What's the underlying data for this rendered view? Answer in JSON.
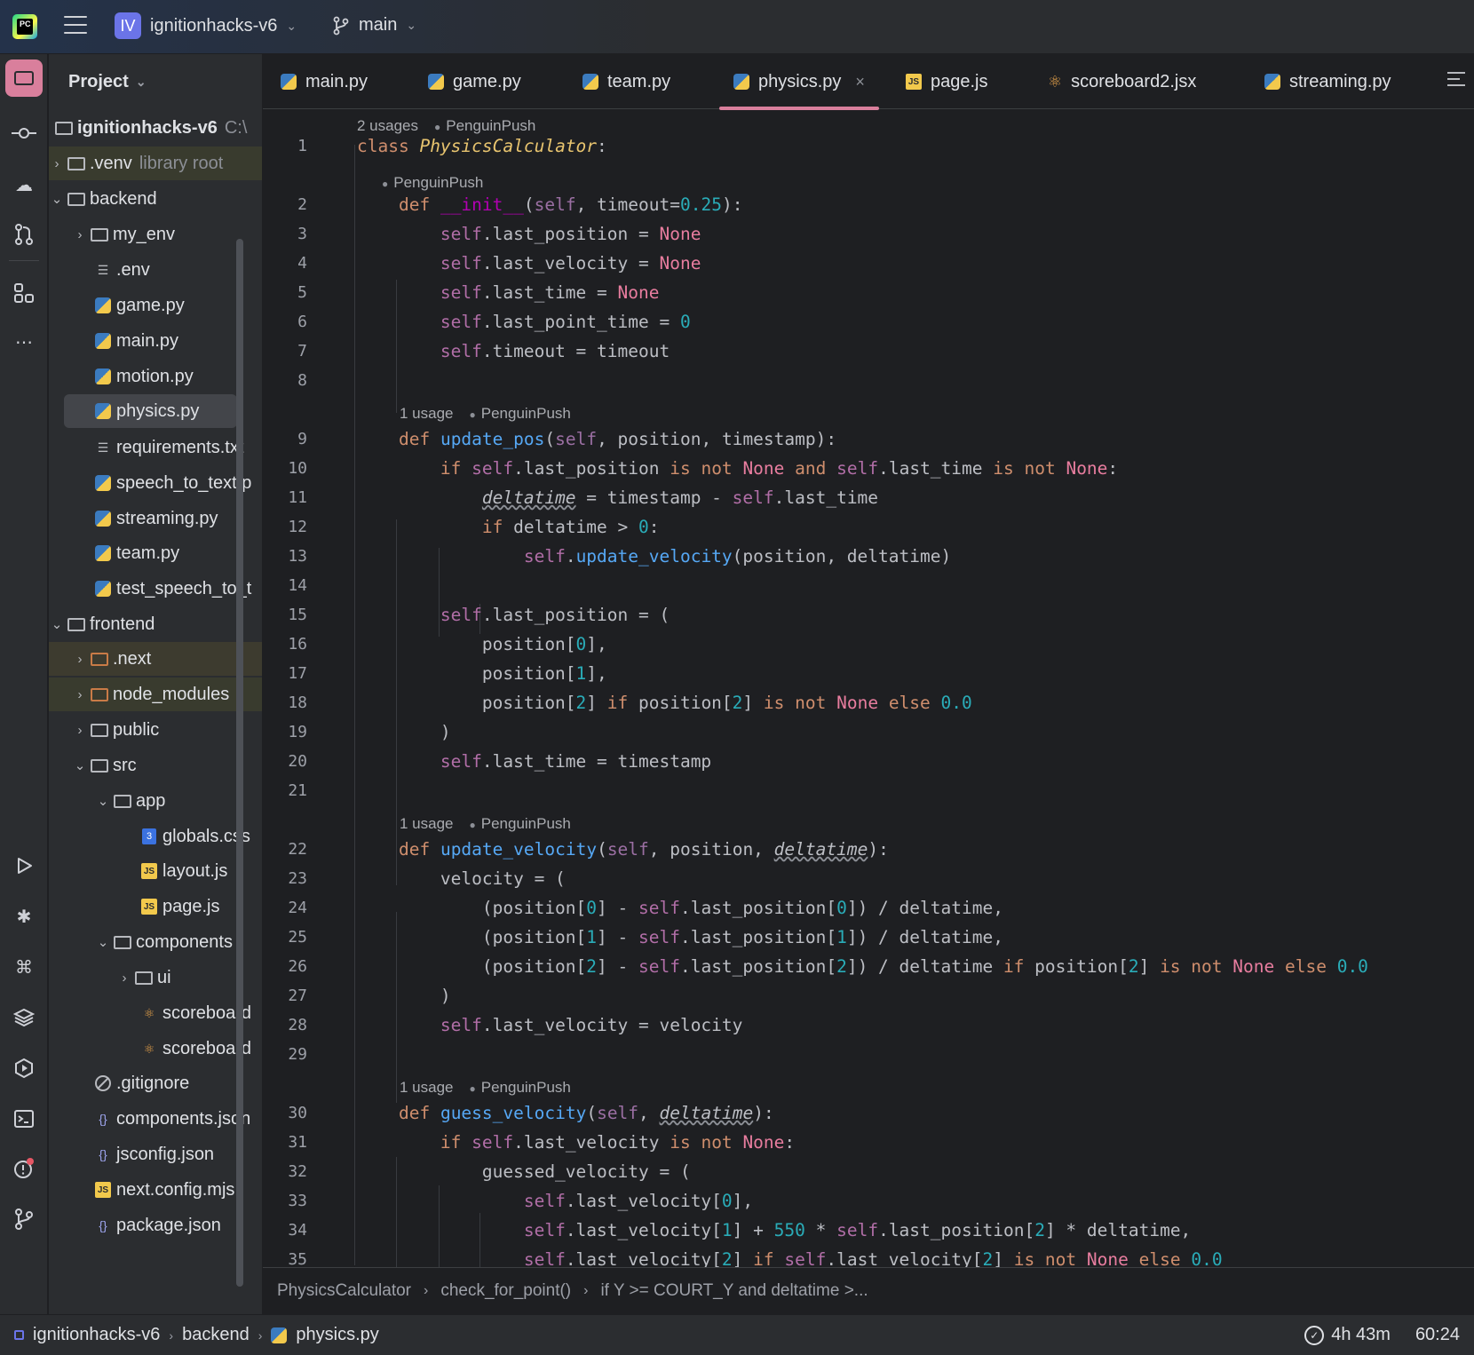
{
  "titlebar": {
    "project_badge": "IV",
    "project_name": "ignitionhacks-v6",
    "branch": "main"
  },
  "project_panel": {
    "title": "Project",
    "root_name": "ignitionhacks-v6",
    "root_path": "C:\\",
    "items": [
      {
        "label": ".venv",
        "hint": "library root"
      },
      {
        "label": "backend"
      },
      {
        "label": "my_env"
      },
      {
        "label": ".env"
      },
      {
        "label": "game.py"
      },
      {
        "label": "main.py"
      },
      {
        "label": "motion.py"
      },
      {
        "label": "physics.py"
      },
      {
        "label": "requirements.txt"
      },
      {
        "label": "speech_to_text.p"
      },
      {
        "label": "streaming.py"
      },
      {
        "label": "team.py"
      },
      {
        "label": "test_speech_to_t"
      },
      {
        "label": "frontend"
      },
      {
        "label": ".next"
      },
      {
        "label": "node_modules",
        "hint": "li"
      },
      {
        "label": "public"
      },
      {
        "label": "src"
      },
      {
        "label": "app"
      },
      {
        "label": "globals.css"
      },
      {
        "label": "layout.js"
      },
      {
        "label": "page.js"
      },
      {
        "label": "components"
      },
      {
        "label": "ui"
      },
      {
        "label": "scoreboard"
      },
      {
        "label": "scoreboard"
      },
      {
        "label": ".gitignore"
      },
      {
        "label": "components.json"
      },
      {
        "label": "jsconfig.json"
      },
      {
        "label": "next.config.mjs"
      },
      {
        "label": "package.json"
      }
    ]
  },
  "tabs": [
    {
      "label": "main.py"
    },
    {
      "label": "game.py"
    },
    {
      "label": "team.py"
    },
    {
      "label": "physics.py"
    },
    {
      "label": "page.js"
    },
    {
      "label": "scoreboard2.jsx"
    },
    {
      "label": "streaming.py"
    }
  ],
  "editor": {
    "inlays": {
      "class_usages": "2 usages",
      "author": "PenguinPush",
      "one_usage": "1 usage"
    },
    "line_numbers": [
      "1",
      "2",
      "3",
      "4",
      "5",
      "6",
      "7",
      "8",
      "9",
      "10",
      "11",
      "12",
      "13",
      "14",
      "15",
      "16",
      "17",
      "18",
      "19",
      "20",
      "21",
      "22",
      "23",
      "24",
      "25",
      "26",
      "27",
      "28",
      "29",
      "30",
      "31",
      "32",
      "33",
      "34",
      "35"
    ]
  },
  "breadcrumbs": [
    "PhysicsCalculator",
    "check_for_point()",
    "if Y >= COURT_Y and deltatime >..."
  ],
  "statusbar": {
    "path": [
      "ignitionhacks-v6",
      "backend",
      "physics.py"
    ],
    "timer": "4h 43m",
    "position": "60:24"
  },
  "colors": {
    "accent": "#d97f9c",
    "background": "#1e1f22",
    "panel": "#2b2d30",
    "keyword": "#cf8e6d",
    "self": "#b16ea7",
    "function": "#56a8f5",
    "number": "#2aacb8"
  }
}
